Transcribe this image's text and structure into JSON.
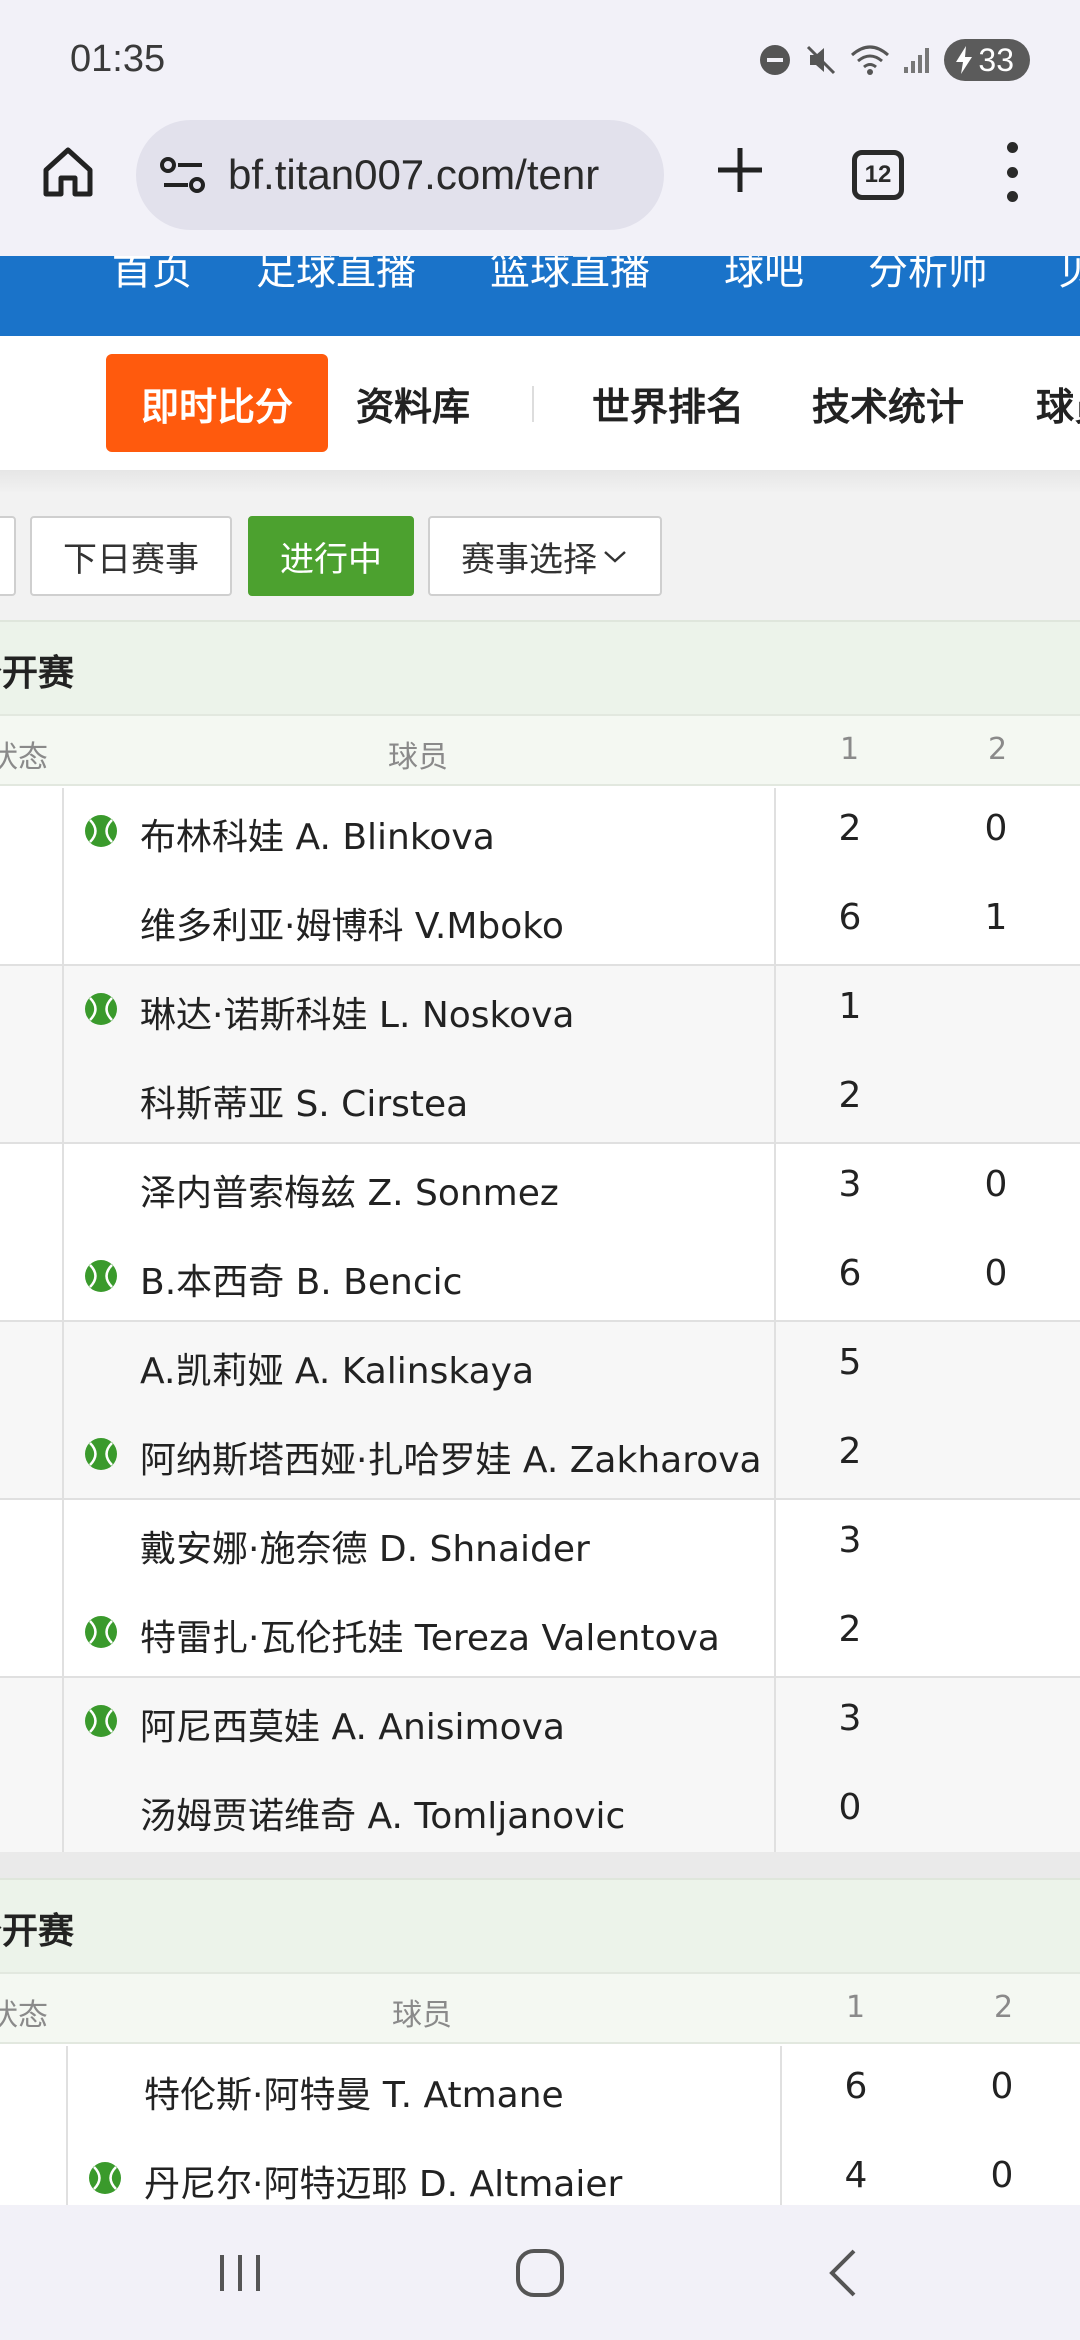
{
  "status": {
    "time": "01:35",
    "battery": "33"
  },
  "browser": {
    "url": "bf.titan007.com/tenr",
    "tab_count": "12"
  },
  "topnav": [
    "首页",
    "足球直播",
    "篮球直播",
    "球吧",
    "分析师",
    "贝"
  ],
  "tabs": {
    "active": "即时比分",
    "library": "资料库",
    "world_rank": "世界排名",
    "tech_stats": "技术统计",
    "more": "球员"
  },
  "filters": {
    "next_day": "下日赛事",
    "live": "进行中",
    "select": "赛事选择"
  },
  "sections": [
    {
      "title": "公开赛",
      "col_status": "状态",
      "col_player": "球员",
      "col_1": "1",
      "col_2": "2",
      "matches": [
        {
          "p1": {
            "name": "布林科娃 A. Blinkova",
            "s1": "2",
            "s2": "0",
            "serve": true
          },
          "p2": {
            "name": "维多利亚·姆博科 V.Mboko",
            "s1": "6",
            "s2": "1",
            "serve": false
          }
        },
        {
          "p1": {
            "name": "琳达·诺斯科娃 L. Noskova",
            "s1": "1",
            "s2": "",
            "serve": true
          },
          "p2": {
            "name": "科斯蒂亚 S. Cirstea",
            "s1": "2",
            "s2": "",
            "serve": false
          }
        },
        {
          "p1": {
            "name": "泽内普索梅兹 Z. Sonmez",
            "s1": "3",
            "s2": "0",
            "serve": false
          },
          "p2": {
            "name": "B.本西奇 B. Bencic",
            "s1": "6",
            "s2": "0",
            "serve": true
          }
        },
        {
          "p1": {
            "name": "A.凯莉娅 A. Kalinskaya",
            "s1": "5",
            "s2": "",
            "serve": false
          },
          "p2": {
            "name": "阿纳斯塔西娅·扎哈罗娃 A. Zakharova",
            "s1": "2",
            "s2": "",
            "serve": true
          }
        },
        {
          "p1": {
            "name": "戴安娜·施奈德 D. Shnaider",
            "s1": "3",
            "s2": "",
            "serve": false
          },
          "p2": {
            "name": "特雷扎·瓦伦托娃 Tereza Valentova",
            "s1": "2",
            "s2": "",
            "serve": true
          }
        },
        {
          "p1": {
            "name": "阿尼西莫娃 A. Anisimova",
            "s1": "3",
            "s2": "",
            "serve": true
          },
          "p2": {
            "name": "汤姆贾诺维奇 A. Tomljanovic",
            "s1": "0",
            "s2": "",
            "serve": false
          }
        }
      ]
    },
    {
      "title": "公开赛",
      "col_status": "状态",
      "col_player": "球员",
      "col_1": "1",
      "col_2": "2",
      "matches": [
        {
          "p1": {
            "name": "特伦斯·阿特曼 T. Atmane",
            "s1": "6",
            "s2": "0",
            "serve": false
          },
          "p2": {
            "name": "丹尼尔·阿特迈耶 D. Altmaier",
            "s1": "4",
            "s2": "0",
            "serve": true
          }
        }
      ]
    }
  ],
  "colors": {
    "accent_orange": "#ff5a0d",
    "live_green": "#4ca12f",
    "nav_blue": "#1a73c9",
    "ball_green": "#3a9a2c"
  },
  "icons": [
    "home-icon",
    "site-settings-icon",
    "plus-icon",
    "tabs-icon",
    "more-vert-icon",
    "tennis-ball-icon",
    "recent-apps-icon",
    "home-nav-icon",
    "back-icon"
  ]
}
